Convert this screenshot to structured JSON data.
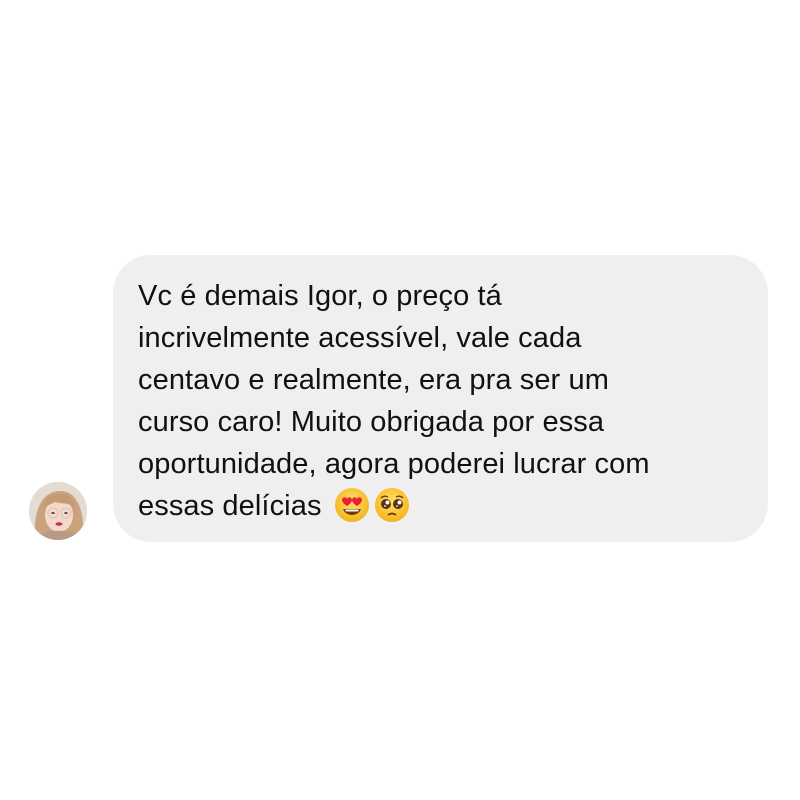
{
  "message": {
    "lines": [
      "Vc é demais Igor, o preço tá",
      "incrivelmente acessível, vale cada",
      "centavo e realmente, era pra ser um",
      "curso caro! Muito obrigada por essa",
      "oportunidade, agora poderei lucrar com",
      "essas delícias"
    ],
    "emojis": [
      "heart-eyes-emoji",
      "pleading-face-emoji"
    ]
  },
  "sender": {
    "avatar_icon": "profile-photo"
  },
  "colors": {
    "bubble": "#efefef",
    "text": "#111111",
    "background": "#ffffff"
  }
}
